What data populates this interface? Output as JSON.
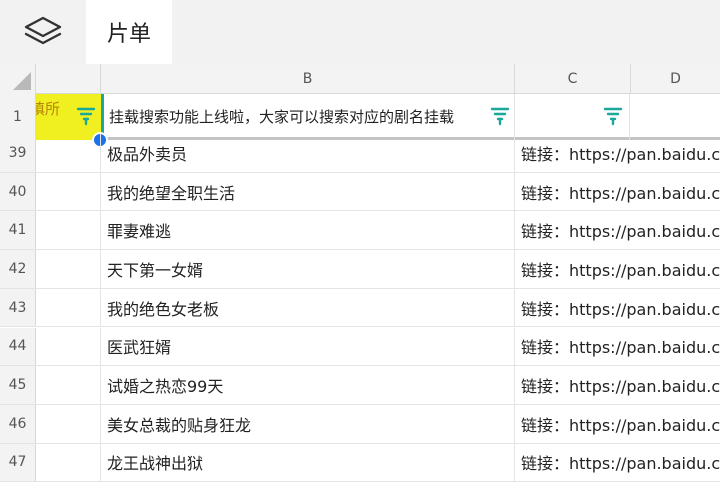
{
  "topbar": {
    "layers_icon": "layers-icon",
    "tab_label": "片单"
  },
  "sheet": {
    "columns": [
      "B",
      "C",
      "D"
    ],
    "frozen_row": {
      "row_number": "1",
      "a1_text": "瑱所",
      "b1_text": "挂载搜索功能上线啦，大家可以搜索对应的剧名挂载",
      "filter_icon": "filter-icon",
      "accent_color": "#1aa89a",
      "a1_fill": "#f0f021"
    },
    "rows": [
      {
        "num": "39",
        "b": "极品外卖员",
        "c": "链接：https://pan.baidu.com"
      },
      {
        "num": "40",
        "b": "我的绝望全职生活",
        "c": "链接：https://pan.baidu.com"
      },
      {
        "num": "41",
        "b": "罪妻难逃",
        "c": "链接：https://pan.baidu.com"
      },
      {
        "num": "42",
        "b": "天下第一女婿",
        "c": "链接：https://pan.baidu.com"
      },
      {
        "num": "43",
        "b": "我的绝色女老板",
        "c": "链接：https://pan.baidu.com"
      },
      {
        "num": "44",
        "b": "医武狂婿",
        "c": "链接：https://pan.baidu.com"
      },
      {
        "num": "45",
        "b": "试婚之热恋99天",
        "c": "链接：https://pan.baidu.com"
      },
      {
        "num": "46",
        "b": "美女总裁的贴身狂龙",
        "c": "链接：https://pan.baidu.com"
      },
      {
        "num": "47",
        "b": "龙王战神出狱",
        "c": "链接：https://pan.baidu.com"
      }
    ]
  }
}
